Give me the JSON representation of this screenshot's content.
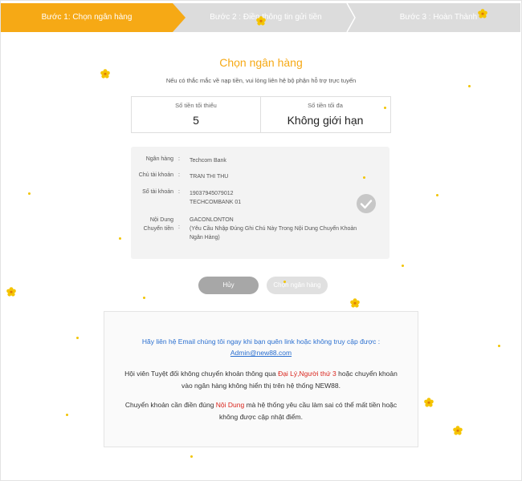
{
  "steps": [
    {
      "label": "Bước 1: Chọn ngân hàng"
    },
    {
      "label": "Bước 2 : Điền thông tin gửi tiền"
    },
    {
      "label": "Bước 3 : Hoàn Thành"
    }
  ],
  "heading": {
    "title": "Chọn ngân hàng",
    "subtitle": "Nếu có thắc mắc về nạp tiền, vui lòng liên hệ bộ phận hỗ trợ trực tuyến"
  },
  "limits": {
    "min_label": "Số tiền tối thiểu",
    "min_value": "5",
    "max_label": "Số tiền tối đa",
    "max_value": "Không giới hạn"
  },
  "bank": {
    "colon": ":",
    "bank_label": "Ngân hàng",
    "bank_value": "Techcom Bank",
    "owner_label": "Chủ tài khoản",
    "owner_value": "TRAN THI THU",
    "account_label": "Số tài khoản",
    "account_line1": "19037945079012",
    "account_line2": "TECHCOMBANK 01",
    "content_label1": "Nội Dung",
    "content_label2": "Chuyển tiền",
    "content_line1": "GACONLONTON",
    "content_line2": "(Yêu Cầu Nhập Đúng Ghi Chú Này Trong Nội Dung Chuyển Khoản",
    "content_line3": "Ngân Hàng)"
  },
  "buttons": {
    "cancel": "Hủy",
    "choose": "Chọn ngân hàng"
  },
  "notice": {
    "contact_line": "Hãy liên hệ Email chúng tôi ngay khi bạn quên link hoặc không truy cập được :",
    "email": "Admin@new88.com",
    "p1_a": "Hội viên Tuyệt đối không chuyển khoản thông qua ",
    "p1_red": "Đại Lý,Người thứ 3",
    "p1_b": " hoặc chuyển khoản vào ngân hàng không hiển thị trên hệ thống NEW88.",
    "p2_a": "Chuyển khoản cần điền đúng ",
    "p2_red": "Nội Dung",
    "p2_b": " mà hệ thống yêu cầu làm sai có thể mất tiền hoặc không được cập nhật điểm."
  },
  "colors": {
    "accent": "#f6a915",
    "link": "#2a6fd0",
    "warning": "#d9241c",
    "flower": "#f5c400"
  }
}
